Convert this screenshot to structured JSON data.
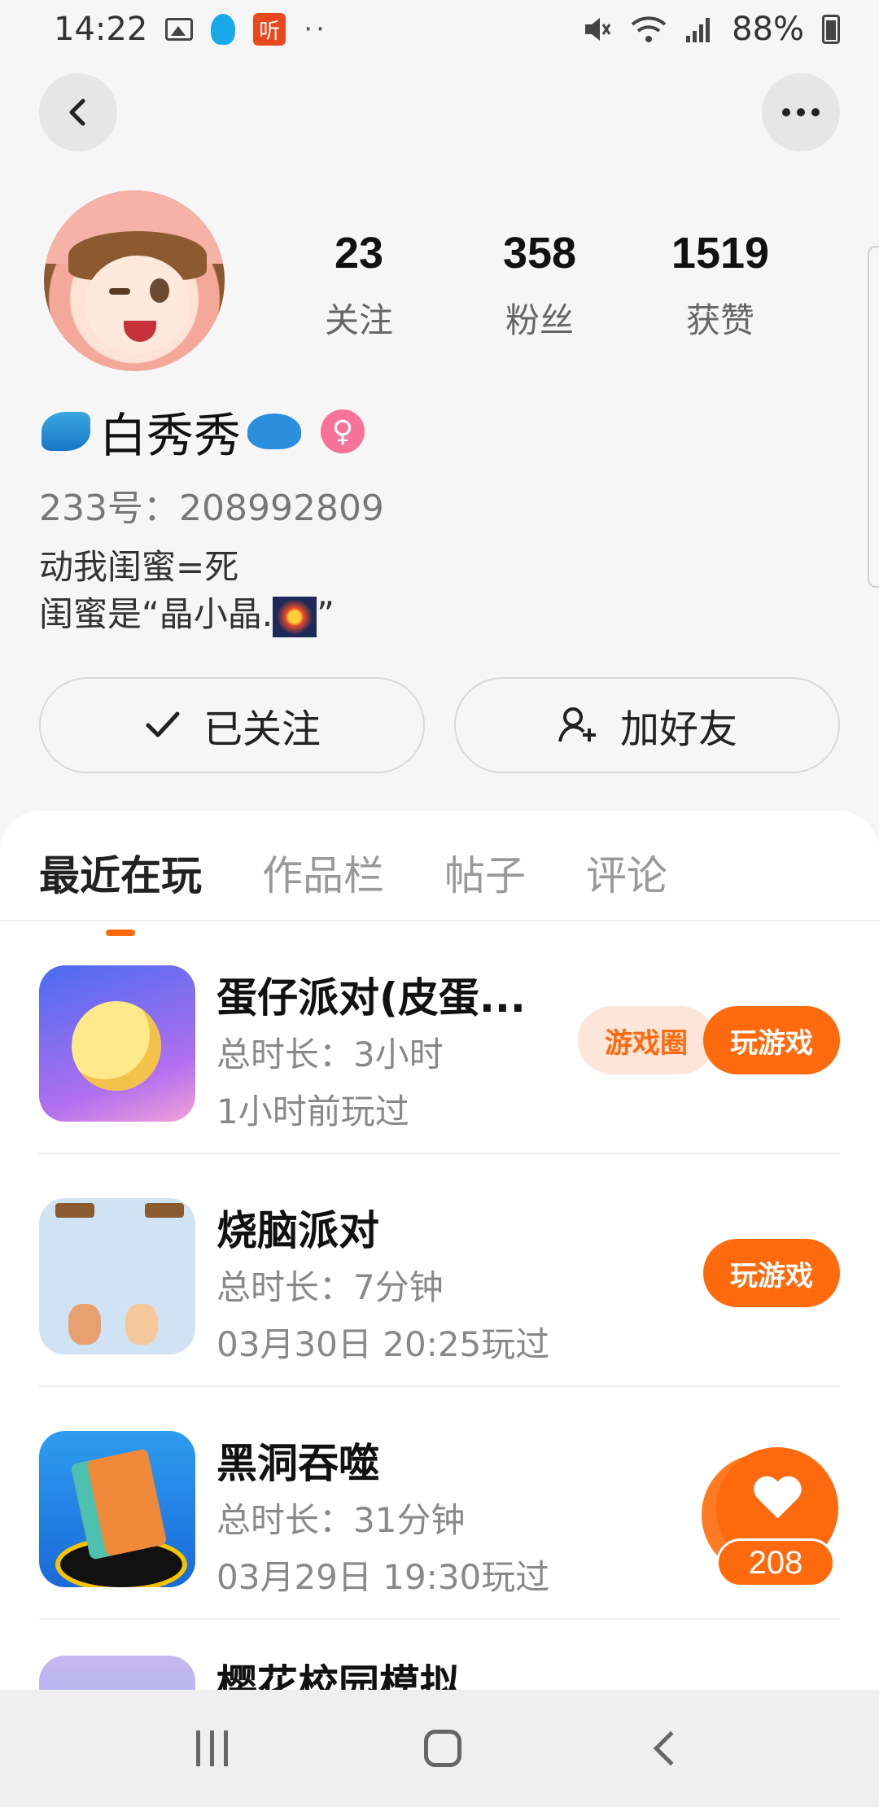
{
  "status_bar": {
    "time": "14:22",
    "notification_icons": [
      "image-icon",
      "qq-icon",
      "ting-icon"
    ],
    "ting_label": "听",
    "more_dots": "··",
    "battery": "88%"
  },
  "profile": {
    "stats": [
      {
        "value": "23",
        "label": "关注"
      },
      {
        "value": "358",
        "label": "粉丝"
      },
      {
        "value": "1519",
        "label": "获赞"
      }
    ],
    "name": "白秀秀",
    "gender_symbol": "♀",
    "uid": "233号：208992809",
    "bio_line1": "动我闺蜜=死",
    "bio_line2": "闺蜜是“晶小晶.",
    "bio_line2_suffix": "”",
    "follow_button": "已关注",
    "add_friend_button": "加好友"
  },
  "tabs": [
    {
      "label": "最近在玩",
      "active": true
    },
    {
      "label": "作品栏",
      "active": false
    },
    {
      "label": "帖子",
      "active": false
    },
    {
      "label": "评论",
      "active": false
    }
  ],
  "games": [
    {
      "title": "蛋仔派对(皮蛋...",
      "duration": "总时长：3小时",
      "last_played": "1小时前玩过",
      "circle_button": "游戏圈",
      "play_button": "玩游戏"
    },
    {
      "title": "烧脑派对",
      "duration": "总时长：7分钟",
      "last_played": "03月30日 20:25玩过",
      "play_button": "玩游戏"
    },
    {
      "title": "黑洞吞噬",
      "duration": "总时长：31分钟",
      "last_played": "03月29日 19:30玩过"
    },
    {
      "title": "樱花校园模拟"
    }
  ],
  "like_fab": {
    "count": "208"
  },
  "colors": {
    "accent": "#ff6a0e",
    "accent_light": "#fde5da",
    "background": "#f6f6f6"
  }
}
